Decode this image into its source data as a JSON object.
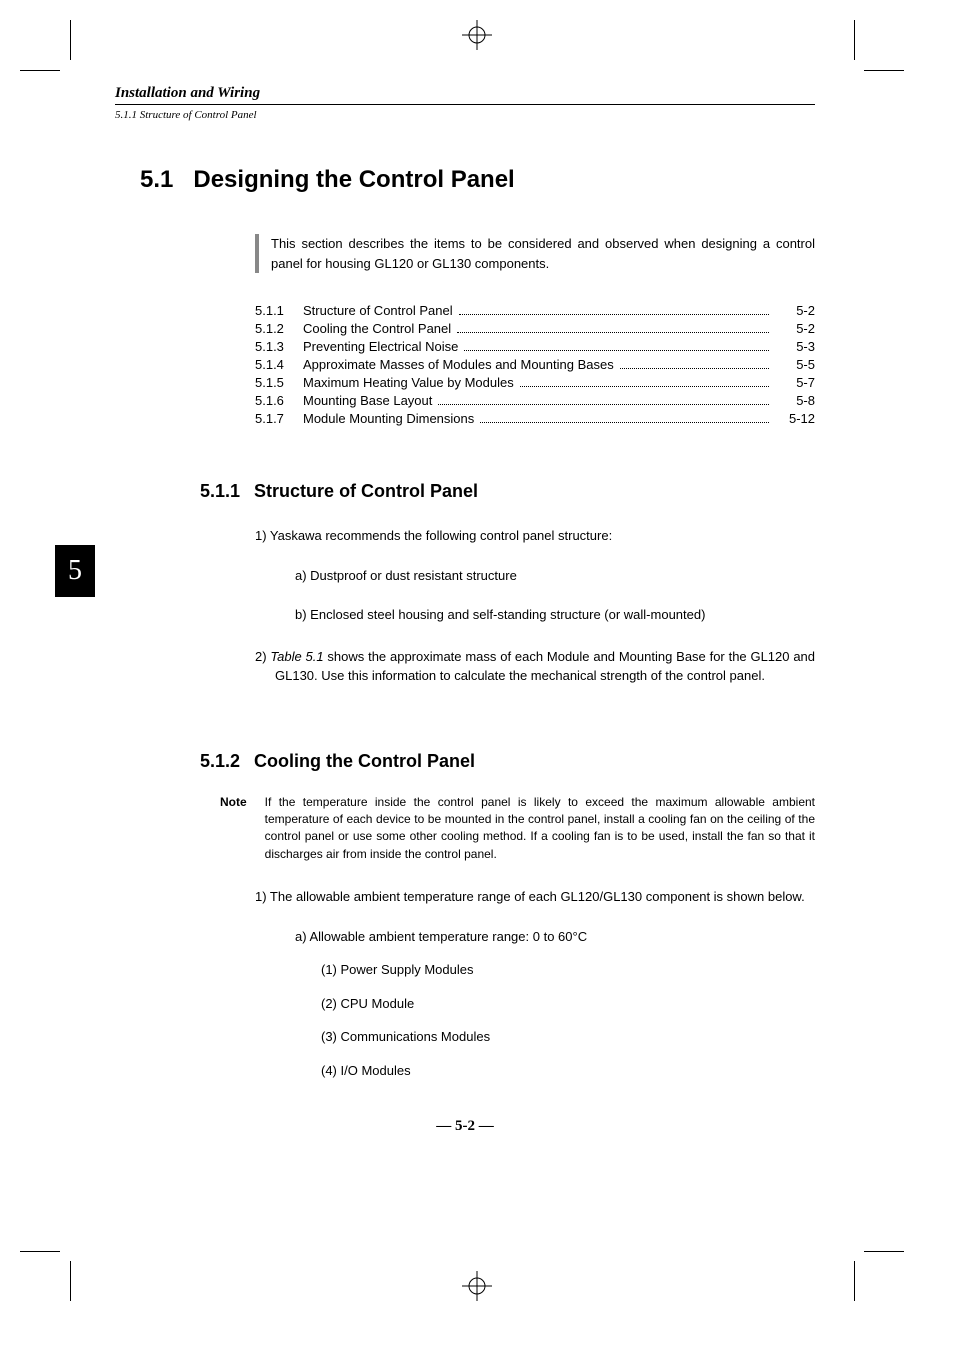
{
  "running_head": "Installation and Wiring",
  "running_sub": "5.1.1 Structure of Control Panel",
  "chapter_tab": "5",
  "section": {
    "number": "5.1",
    "title": "Designing the Control Panel",
    "intro": "This section describes the items to be considered and observed when designing a control panel for housing GL120 or GL130 components."
  },
  "toc": [
    {
      "num": "5.1.1",
      "title": "Structure of Control Panel",
      "page": "5-2"
    },
    {
      "num": "5.1.2",
      "title": "Cooling the Control Panel",
      "page": "5-2"
    },
    {
      "num": "5.1.3",
      "title": "Preventing Electrical Noise",
      "page": "5-3"
    },
    {
      "num": "5.1.4",
      "title": "Approximate Masses of Modules and Mounting Bases",
      "page": "5-5"
    },
    {
      "num": "5.1.5",
      "title": "Maximum Heating Value by Modules",
      "page": "5-7"
    },
    {
      "num": "5.1.6",
      "title": "Mounting Base Layout",
      "page": "5-8"
    },
    {
      "num": "5.1.7",
      "title": "Module Mounting Dimensions",
      "page": "5-12"
    }
  ],
  "sub1": {
    "number": "5.1.1",
    "title": "Structure of Control Panel",
    "item1_lead": "1) Yaskawa recommends the following control panel structure:",
    "item1a": "a)  Dustproof or dust resistant structure",
    "item1b": "b)  Enclosed steel housing and self-standing structure (or wall-mounted)",
    "item2_prefix": "2) ",
    "item2_ref": "Table 5.1",
    "item2_rest": " shows the approximate mass of each Module and Mounting Base for the GL120 and GL130. Use this information to calculate the mechanical strength of the control panel."
  },
  "sub2": {
    "number": "5.1.2",
    "title": "Cooling the Control Panel",
    "note_label": "Note",
    "note_text": "If the temperature inside the control panel is likely to exceed the maximum allowable ambient temperature of each device to be mounted in the control panel, install a cooling fan on the ceiling of the control panel or use some other cooling method. If a cooling fan is to be used, install the fan so that it discharges air from inside the control panel.",
    "item1": "1) The allowable ambient temperature range of each GL120/GL130 component is shown below.",
    "item1a_prefix": "a)  Allowable ambient temperature range: 0 to 60",
    "item1a_unit": "°",
    "item1a_suffix": "C",
    "p1": "(1)  Power Supply Modules",
    "p2": "(2)  CPU Module",
    "p3": "(3)  Communications Modules",
    "p4": "(4)  I/O Modules"
  },
  "page_number": "— 5-2 —"
}
